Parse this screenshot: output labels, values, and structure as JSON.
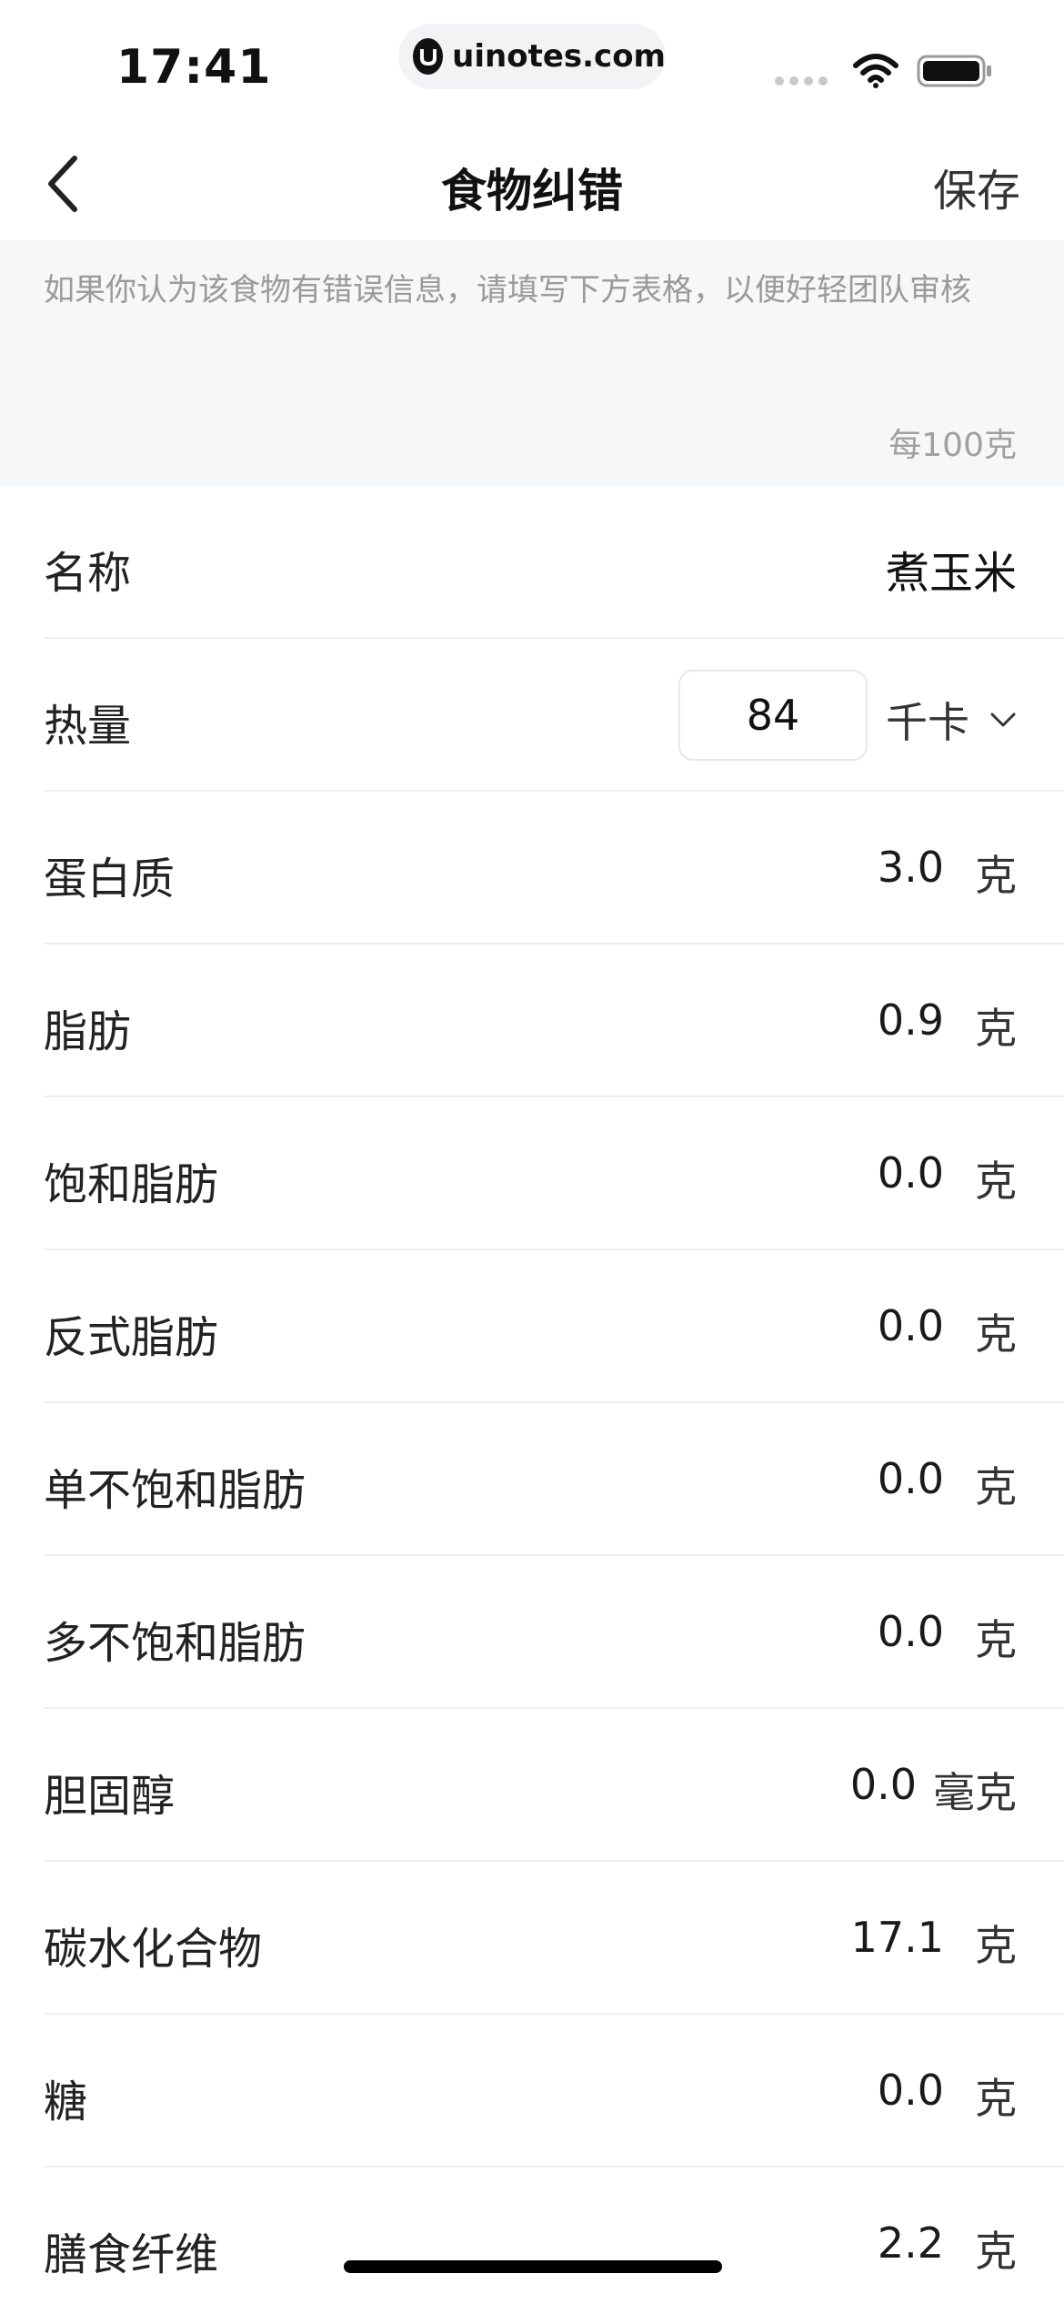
{
  "status_bar": {
    "time": "17:41",
    "url": "uinotes.com",
    "icons": [
      "signal-icon",
      "wifi-icon",
      "battery-icon"
    ]
  },
  "nav": {
    "title": "食物纠错",
    "save_label": "保存",
    "back_icon": "chevron-left-icon"
  },
  "notice": {
    "text": "如果你认为该食物有错误信息，请填写下方表格，以便好轻团队审核",
    "unit_note": "每100克"
  },
  "form": {
    "name": {
      "label": "名称",
      "value": "煮玉米"
    },
    "calories": {
      "label": "热量",
      "value": "84",
      "unit": "千卡"
    },
    "nutrients": [
      {
        "label": "蛋白质",
        "value": "3.0",
        "unit": "克"
      },
      {
        "label": "脂肪",
        "value": "0.9",
        "unit": "克"
      },
      {
        "label": "饱和脂肪",
        "value": "0.0",
        "unit": "克"
      },
      {
        "label": "反式脂肪",
        "value": "0.0",
        "unit": "克"
      },
      {
        "label": "单不饱和脂肪",
        "value": "0.0",
        "unit": "克"
      },
      {
        "label": "多不饱和脂肪",
        "value": "0.0",
        "unit": "克"
      },
      {
        "label": "胆固醇",
        "value": "0.0",
        "unit": "毫克"
      },
      {
        "label": "碳水化合物",
        "value": "17.1",
        "unit": "克"
      },
      {
        "label": "糖",
        "value": "0.0",
        "unit": "克"
      },
      {
        "label": "膳食纤维",
        "value": "2.2",
        "unit": "克"
      }
    ]
  },
  "colors": {
    "notice_bg": "#f6f7f9",
    "divider": "#efefef",
    "muted_text": "#9a9a9a"
  }
}
